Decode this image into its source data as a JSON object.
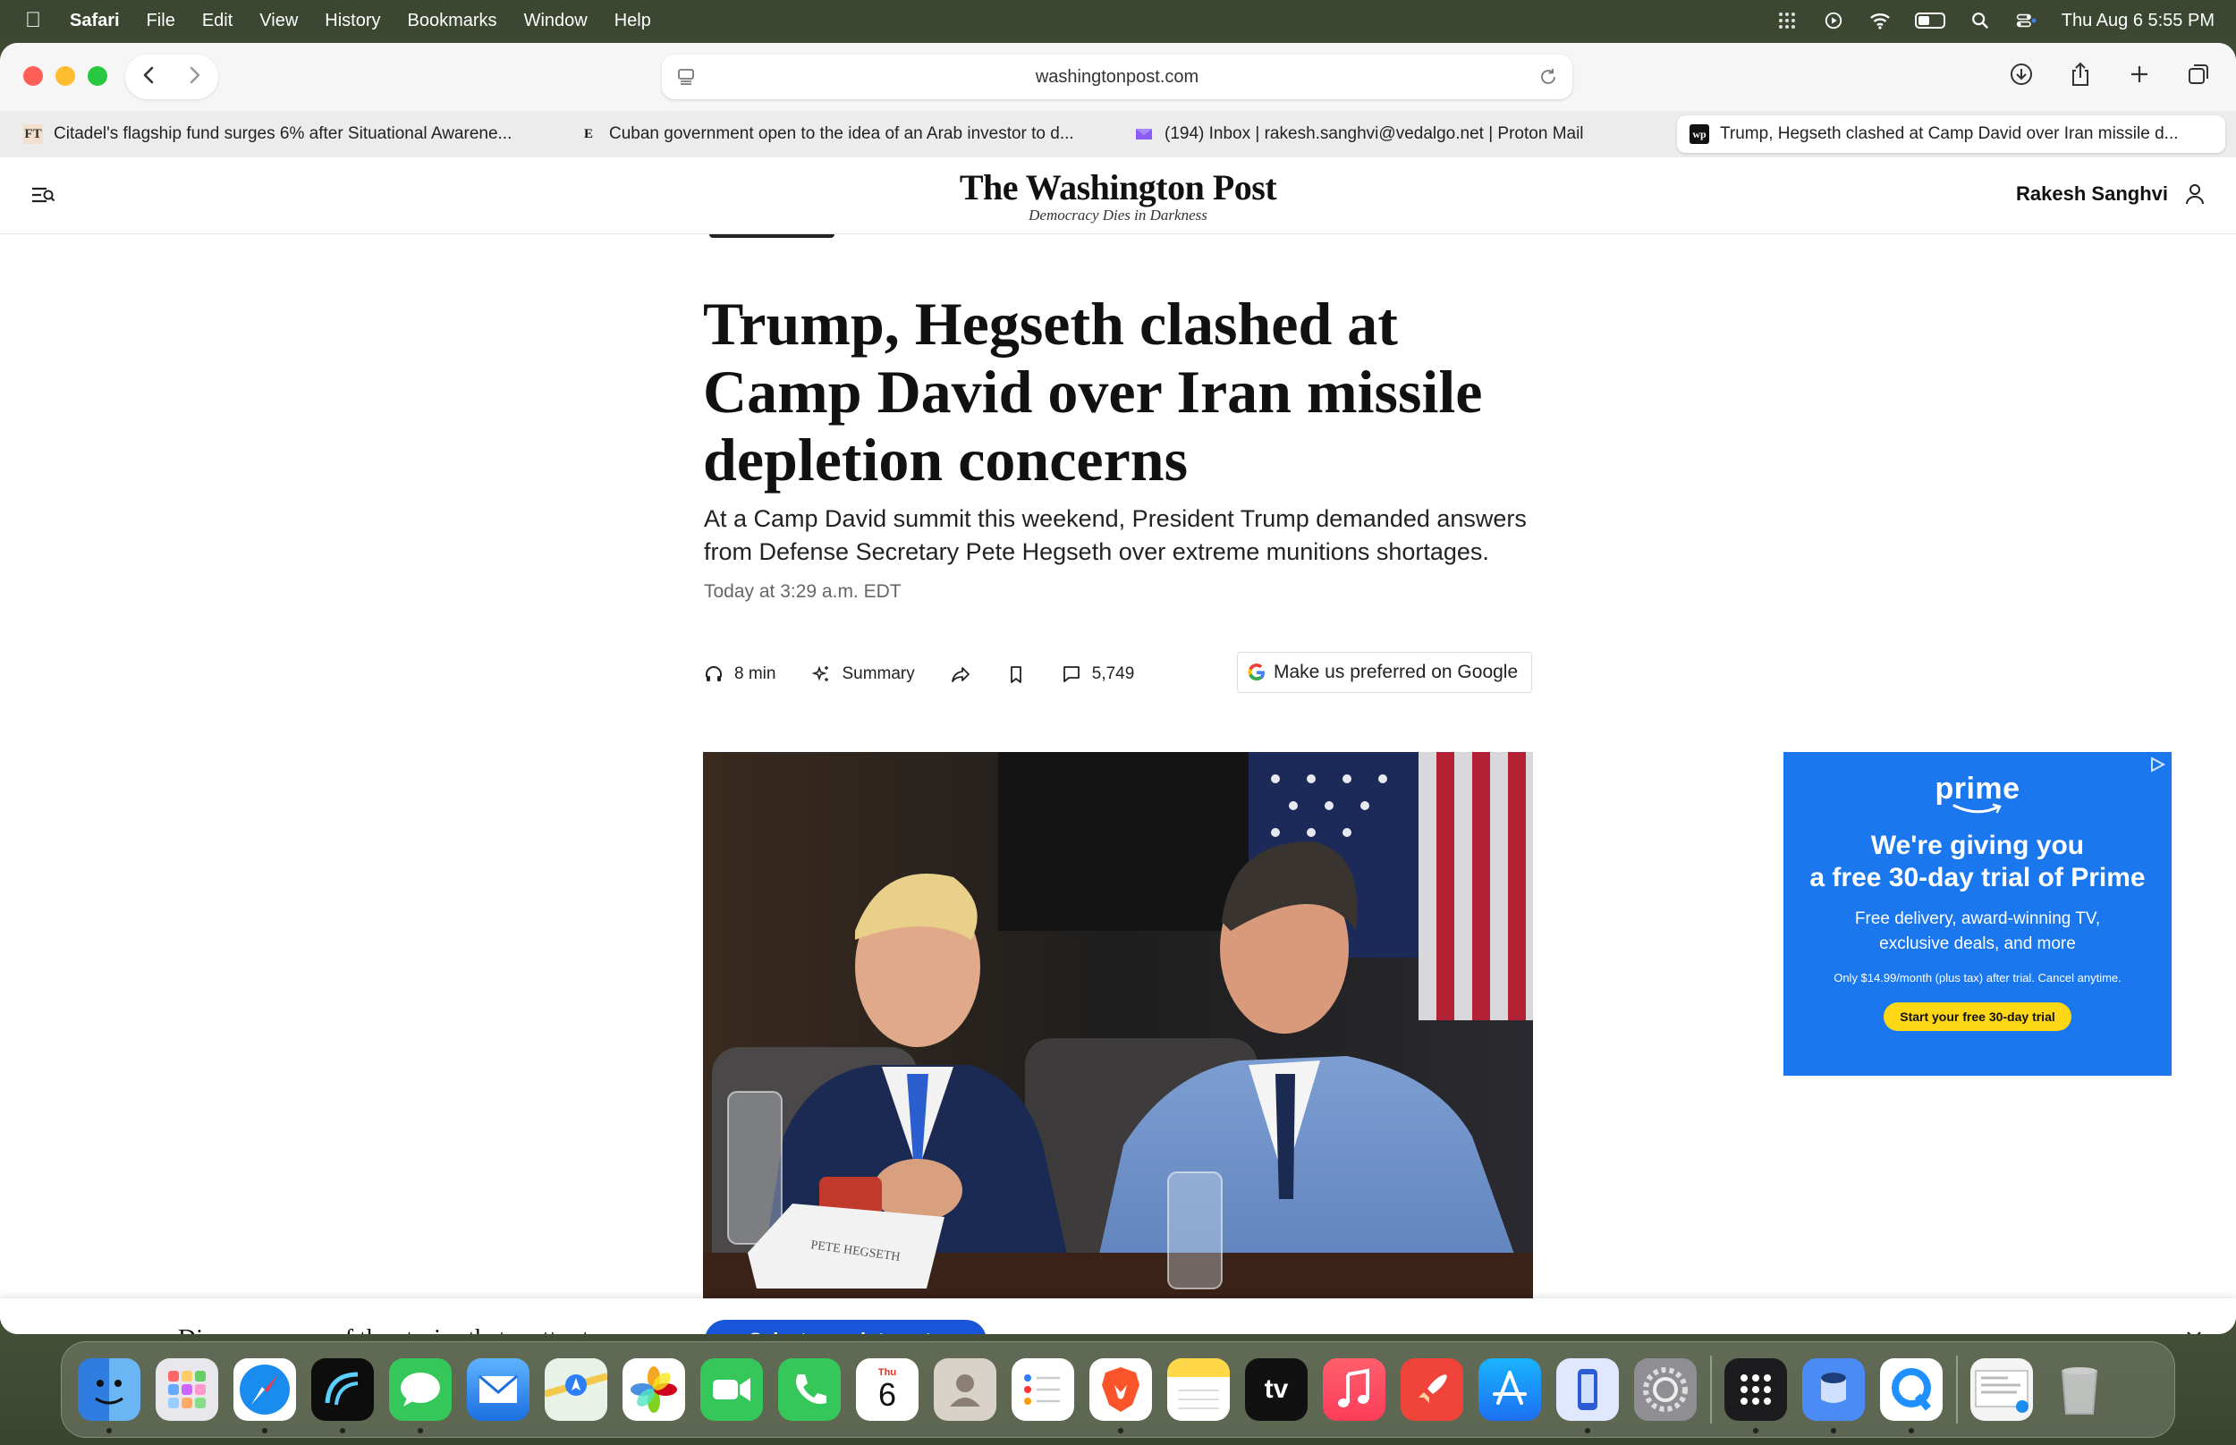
{
  "menubar": {
    "app": "Safari",
    "items": [
      "File",
      "Edit",
      "View",
      "History",
      "Bookmarks",
      "Window",
      "Help"
    ],
    "clock": "Thu Aug 6  5:55 PM"
  },
  "browser": {
    "url": "washingtonpost.com",
    "tabs": [
      {
        "favicon": "FT",
        "title": "Citadel's flagship fund surges 6% after Situational Awarene..."
      },
      {
        "favicon": "E",
        "title": "Cuban government open to the idea of an Arab investor to d..."
      },
      {
        "favicon": "mail-icon",
        "title": "(194) Inbox | rakesh.sanghvi@vedalgo.net | Proton Mail"
      },
      {
        "favicon": "wp",
        "title": "Trump, Hegseth clashed at Camp David over Iran missile d..."
      }
    ]
  },
  "site": {
    "logo": "The Washington Post",
    "tagline": "Democracy Dies in Darkness",
    "user": "Rakesh Sanghvi"
  },
  "article": {
    "headline": "Trump, Hegseth clashed at Camp David over Iran missile depletion concerns",
    "dek": "At a Camp David summit this weekend, President Trump demanded answers from Defense Secretary Pete Hegseth over extreme munitions shortages.",
    "timestamp": "Today at 3:29 a.m. EDT",
    "listen": "8 min",
    "summary": "Summary",
    "comments": "5,749",
    "google_cta": "Make us preferred on Google",
    "photo_placard": "PETE HEGSETH"
  },
  "ad": {
    "brand": "prime",
    "headline_1": "We're giving you",
    "headline_2": "a free 30-day trial of Prime",
    "sub_1": "Free delivery, award-winning TV,",
    "sub_2": "exclusive deals, and more",
    "fine": "Only $14.99/month (plus tax) after trial. Cancel anytime.",
    "cta": "Start your free 30-day trial",
    "colors": {
      "bg": "#1a77ee",
      "cta": "#fed814"
    }
  },
  "banner": {
    "text": "Discover more of the stories that matter to you.",
    "button": "Select your interests"
  },
  "dock": {
    "calendar_day": "Thu",
    "calendar_date": "6",
    "tv_label": "tv"
  }
}
